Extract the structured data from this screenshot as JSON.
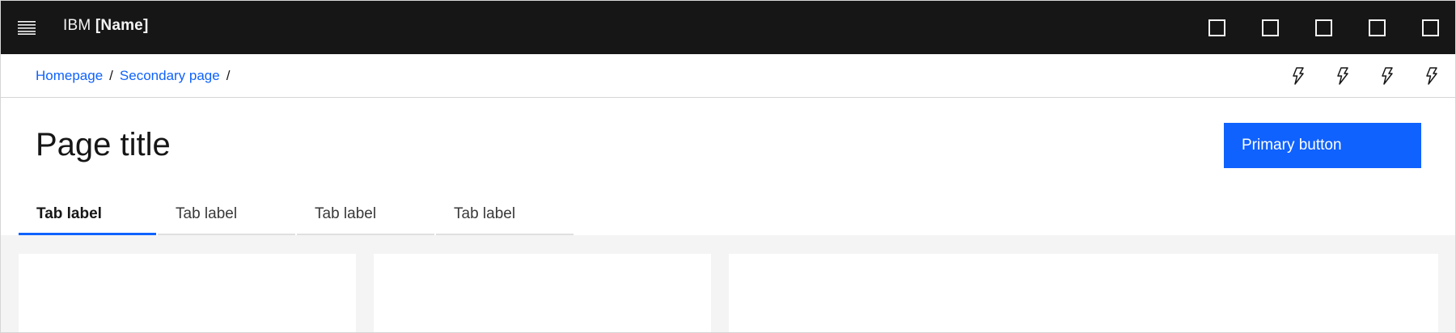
{
  "header": {
    "brand_prefix": "IBM",
    "brand_name": "[Name]",
    "menu_icon": "hamburger-menu-icon",
    "actions": [
      {
        "icon": "square-icon"
      },
      {
        "icon": "square-icon"
      },
      {
        "icon": "square-icon"
      },
      {
        "icon": "square-icon"
      },
      {
        "icon": "square-icon"
      }
    ]
  },
  "breadcrumb": {
    "items": [
      {
        "label": "Homepage"
      },
      {
        "label": "Secondary page"
      }
    ],
    "separator": "/"
  },
  "utility_actions": [
    {
      "icon": "lightning-icon"
    },
    {
      "icon": "lightning-icon"
    },
    {
      "icon": "lightning-icon"
    },
    {
      "icon": "lightning-icon"
    }
  ],
  "page": {
    "title": "Page title",
    "primary_button": "Primary button"
  },
  "tabs": [
    {
      "label": "Tab label",
      "selected": true
    },
    {
      "label": "Tab label",
      "selected": false
    },
    {
      "label": "Tab label",
      "selected": false
    },
    {
      "label": "Tab label",
      "selected": false
    }
  ],
  "colors": {
    "header_bg": "#161616",
    "accent": "#0f62fe",
    "link": "#0f62fe",
    "page_bg": "#f4f4f4",
    "surface": "#ffffff"
  }
}
